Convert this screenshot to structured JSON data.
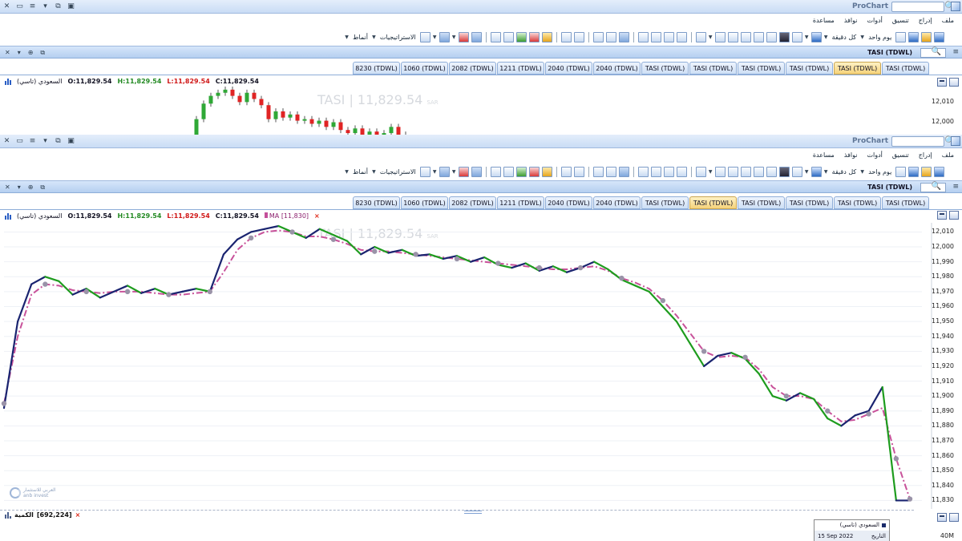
{
  "app": {
    "title": "ProChart"
  },
  "menu": [
    "ملف",
    "إدراج",
    "تنسيق",
    "أدوات",
    "نوافذ",
    "مساعدة"
  ],
  "toolbar": {
    "patterns_label": "أنماط",
    "strategies_label": "الاستراتيجيات",
    "interval_label": "كل دقيقة",
    "period_label": "يوم واحد"
  },
  "window1": {
    "subtitle": "TASI (TDWL)",
    "tabs": [
      "8230 (TDWL)",
      "1060 (TDWL)",
      "2082 (TDWL)",
      "1211 (TDWL)",
      "2040 (TDWL)",
      "2040 (TDWL)",
      "TASI (TDWL)",
      "TASI (TDWL)",
      "TASI (TDWL)",
      "TASI (TDWL)",
      "TASI (TDWL)",
      "TASI (TDWL)"
    ],
    "active_tab": 10,
    "quote": {
      "name": "(السعودي (تاسي",
      "open": "O:11,829.54",
      "high": "H:11,829.54",
      "low": "L:11,829.54",
      "close": "C:11,829.54"
    },
    "watermark": "TASI | 11,829.54",
    "watermark_unit": "SAR",
    "y_ticks": [
      "12,010",
      "12,000"
    ]
  },
  "window2": {
    "subtitle": "TASI (TDWL)",
    "tabs": [
      "8230 (TDWL)",
      "1060 (TDWL)",
      "2082 (TDWL)",
      "1211 (TDWL)",
      "2040 (TDWL)",
      "2040 (TDWL)",
      "TASI (TDWL)",
      "TASI (TDWL)",
      "TASI (TDWL)",
      "TASI (TDWL)",
      "TASI (TDWL)",
      "TASI (TDWL)"
    ],
    "active_tab": 7,
    "quote": {
      "name": "(السعودي (تاسي",
      "open": "O:11,829.54",
      "high": "H:11,829.54",
      "low": "L:11,829.54",
      "close": "C:11,829.54",
      "ma_label": "MA",
      "ma_value": "[11,830]",
      "close_mark": "×"
    },
    "watermark": "TASI | 11,829.54",
    "watermark_unit": "SAR",
    "logo": {
      "line1": "العربي للاستثمار",
      "line2": "anb invest"
    },
    "volume": {
      "label": "الكمية",
      "value": "[692,224]",
      "close_mark": "×"
    },
    "volume_axis": "40M",
    "tooltip": {
      "title": "(السعودي (تاسي",
      "date_label": "التاريخ",
      "date": "15 Sep 2022"
    }
  },
  "chart_data": {
    "type": "line",
    "title": "",
    "xlabel": "",
    "ylabel": "",
    "y_ticks": [
      12010,
      12000,
      11990,
      11980,
      11970,
      11960,
      11950,
      11940,
      11930,
      11920,
      11910,
      11900,
      11890,
      11880,
      11870,
      11860,
      11850,
      11840,
      11830
    ],
    "ylim": [
      11827,
      12014
    ],
    "series": [
      {
        "name": "",
        "style": "price line, up segments navy #1a2470, down segments green #1e9c1e",
        "values": [
          11892,
          11950,
          11975,
          11980,
          11977,
          11968,
          11972,
          11966,
          11970,
          11974,
          11969,
          11972,
          11968,
          11970,
          11972,
          11970,
          11995,
          12005,
          12010,
          12012,
          12014,
          12010,
          12006,
          12012,
          12008,
          12004,
          11995,
          12000,
          11996,
          11998,
          11994,
          11995,
          11992,
          11994,
          11990,
          11993,
          11988,
          11986,
          11989,
          11984,
          11987,
          11983,
          11986,
          11990,
          11985,
          11978,
          11974,
          11970,
          11960,
          11950,
          11935,
          11920,
          11927,
          11929,
          11925,
          11915,
          11900,
          11897,
          11902,
          11898,
          11885,
          11880,
          11887,
          11890,
          11906,
          11830,
          11830
        ]
      },
      {
        "name": "MA",
        "style": "dash-dot, color #c8529a, markers #9a93a8",
        "values": [
          11895,
          11940,
          11968,
          11975,
          11974,
          11971,
          11970,
          11969,
          11970,
          11970,
          11970,
          11969,
          11968,
          11968,
          11969,
          11970,
          11983,
          11998,
          12006,
          12010,
          12011,
          12010,
          12007,
          12007,
          12005,
          12002,
          11998,
          11997,
          11997,
          11996,
          11995,
          11994,
          11993,
          11992,
          11991,
          11990,
          11989,
          11988,
          11987,
          11986,
          11985,
          11985,
          11986,
          11987,
          11984,
          11979,
          11976,
          11972,
          11964,
          11954,
          11942,
          11930,
          11926,
          11927,
          11926,
          11918,
          11906,
          11900,
          11900,
          11898,
          11890,
          11883,
          11884,
          11888,
          11892,
          11858,
          11831
        ]
      }
    ]
  }
}
